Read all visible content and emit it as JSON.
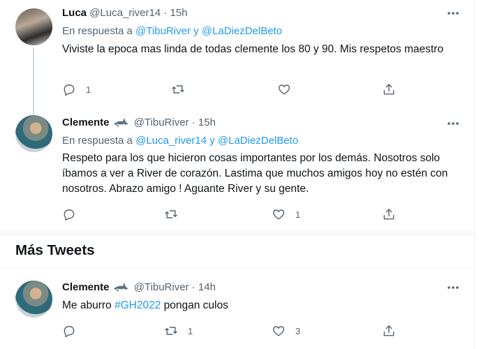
{
  "tweets": [
    {
      "name": "Luca",
      "handle": "@Luca_river14",
      "dot": "·",
      "time": "15h",
      "reply_prefix": "En respuesta a",
      "reply_to_1": "@TibuRiver",
      "reply_join": "y",
      "reply_to_2": "@LaDiezDelBeto",
      "text": "Viviste la epoca mas linda de todas clemente los 80 y 90. Mis respetos maestro",
      "reply_count": "1",
      "retweet_count": "",
      "like_count": ""
    },
    {
      "name": "Clemente",
      "handle": "@TibuRiver",
      "dot": "·",
      "time": "15h",
      "reply_prefix": "En respuesta a",
      "reply_to_1": "@Luca_river14",
      "reply_join": "y",
      "reply_to_2": "@LaDiezDelBeto",
      "text": "Respeto para los que hicieron cosas importantes por los demás. Nosotros solo íbamos a ver a River de corazón.  Lastima que muchos amigos hoy no estén con nosotros. Abrazo amigo ! Aguante River y su gente.",
      "reply_count": "",
      "retweet_count": "",
      "like_count": "1"
    },
    {
      "name": "Clemente",
      "handle": "@TibuRiver",
      "dot": "·",
      "time": "14h",
      "text_before": "Me aburro",
      "hashtag": "#GH2022",
      "text_after": "pongan culos",
      "reply_count": "",
      "retweet_count": "1",
      "like_count": "3"
    }
  ],
  "section": {
    "title": "Más Tweets"
  },
  "colors": {
    "accent": "#1d9bf0",
    "muted": "#536471",
    "text": "#0f1419"
  }
}
